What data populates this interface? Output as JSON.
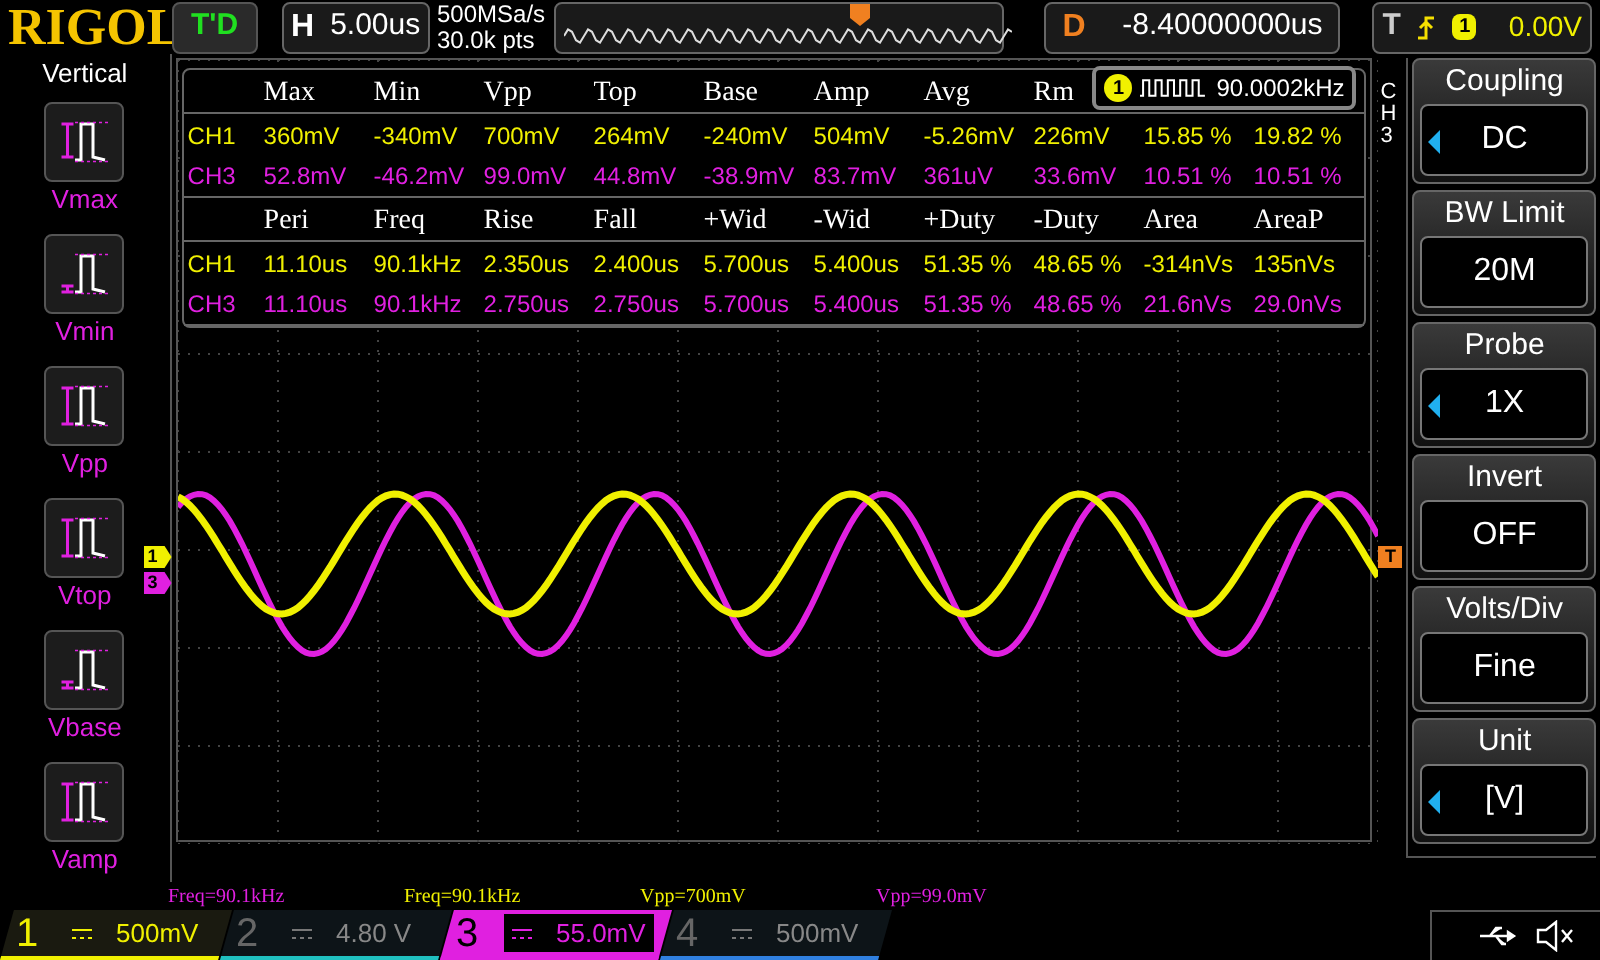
{
  "header": {
    "logo": "RIGOL",
    "run_status": "T'D",
    "horizontal": {
      "label": "H",
      "value": "5.00us"
    },
    "sample_rate": "500MSa/s",
    "points": "30.0k pts",
    "delay": {
      "label": "D",
      "value": "-8.40000000us"
    },
    "trigger": {
      "label": "T",
      "channel": "1",
      "level": "0.00V"
    }
  },
  "left_menu": {
    "title": "Vertical",
    "items": [
      {
        "label": "Vmax",
        "kind": "max"
      },
      {
        "label": "Vmin",
        "kind": "min"
      },
      {
        "label": "Vpp",
        "kind": "pp"
      },
      {
        "label": "Vtop",
        "kind": "top"
      },
      {
        "label": "Vbase",
        "kind": "base"
      },
      {
        "label": "Vamp",
        "kind": "amp"
      }
    ]
  },
  "measurements": [
    {
      "headers": [
        "Max",
        "Min",
        "Vpp",
        "Top",
        "Base",
        "Amp",
        "Avg",
        "Rm"
      ],
      "rows": [
        {
          "channel": "CH1",
          "color": "#f0f000",
          "values": [
            "360mV",
            "-340mV",
            "700mV",
            "264mV",
            "-240mV",
            "504mV",
            "-5.26mV",
            "226mV",
            "15.85 %",
            "19.82 %"
          ]
        },
        {
          "channel": "CH3",
          "color": "#e020e0",
          "values": [
            "52.8mV",
            "-46.2mV",
            "99.0mV",
            "44.8mV",
            "-38.9mV",
            "83.7mV",
            "361uV",
            "33.6mV",
            "10.51 %",
            "10.51 %"
          ]
        }
      ]
    },
    {
      "headers": [
        "Peri",
        "Freq",
        "Rise",
        "Fall",
        "+Wid",
        "-Wid",
        "+Duty",
        "-Duty",
        "Area",
        "AreaP"
      ],
      "rows": [
        {
          "channel": "CH1",
          "color": "#f0f000",
          "values": [
            "11.10us",
            "90.1kHz",
            "2.350us",
            "2.400us",
            "5.700us",
            "5.400us",
            "51.35 %",
            "48.65 %",
            "-314nVs",
            "135nVs"
          ]
        },
        {
          "channel": "CH3",
          "color": "#e020e0",
          "values": [
            "11.10us",
            "90.1kHz",
            "2.750us",
            "2.750us",
            "5.700us",
            "5.400us",
            "51.35 %",
            "48.65 %",
            "21.6nVs",
            "29.0nVs"
          ]
        }
      ]
    }
  ],
  "freq_counter": {
    "channel": "1",
    "value": "90.0002kHz"
  },
  "side_tab": "CH3",
  "channel_markers": [
    {
      "label": "1",
      "color": "#f0f000"
    },
    {
      "label": "3",
      "color": "#e020e0"
    }
  ],
  "trigger_marker": "T",
  "right_menu": [
    {
      "title": "Coupling",
      "value": "DC",
      "arrow": true
    },
    {
      "title": "BW Limit",
      "value": "20M",
      "arrow": false
    },
    {
      "title": "Probe",
      "value": "1X",
      "arrow": true
    },
    {
      "title": "Invert",
      "value": "OFF",
      "arrow": false
    },
    {
      "title": "Volts/Div",
      "value": "Fine",
      "arrow": false
    },
    {
      "title": "Unit",
      "value": "[V]",
      "arrow": true
    }
  ],
  "bottom_labels": [
    {
      "text": "Freq=90.1kHz",
      "color": "#e020e0"
    },
    {
      "text": "Freq=90.1kHz",
      "color": "#f0f000"
    },
    {
      "text": "Vpp=700mV",
      "color": "#f0f000"
    },
    {
      "text": "Vpp=99.0mV",
      "color": "#e020e0"
    }
  ],
  "channels": [
    {
      "number": "1",
      "scale": "500mV",
      "on": true,
      "selected": false,
      "color": "#f0f000"
    },
    {
      "number": "2",
      "scale": "4.80 V",
      "on": false,
      "selected": false,
      "color": "#20c0c0"
    },
    {
      "number": "3",
      "scale": "55.0mV",
      "on": true,
      "selected": true,
      "color": "#e020e0"
    },
    {
      "number": "4",
      "scale": "500mV",
      "on": false,
      "selected": false,
      "color": "#3080e0"
    }
  ]
}
